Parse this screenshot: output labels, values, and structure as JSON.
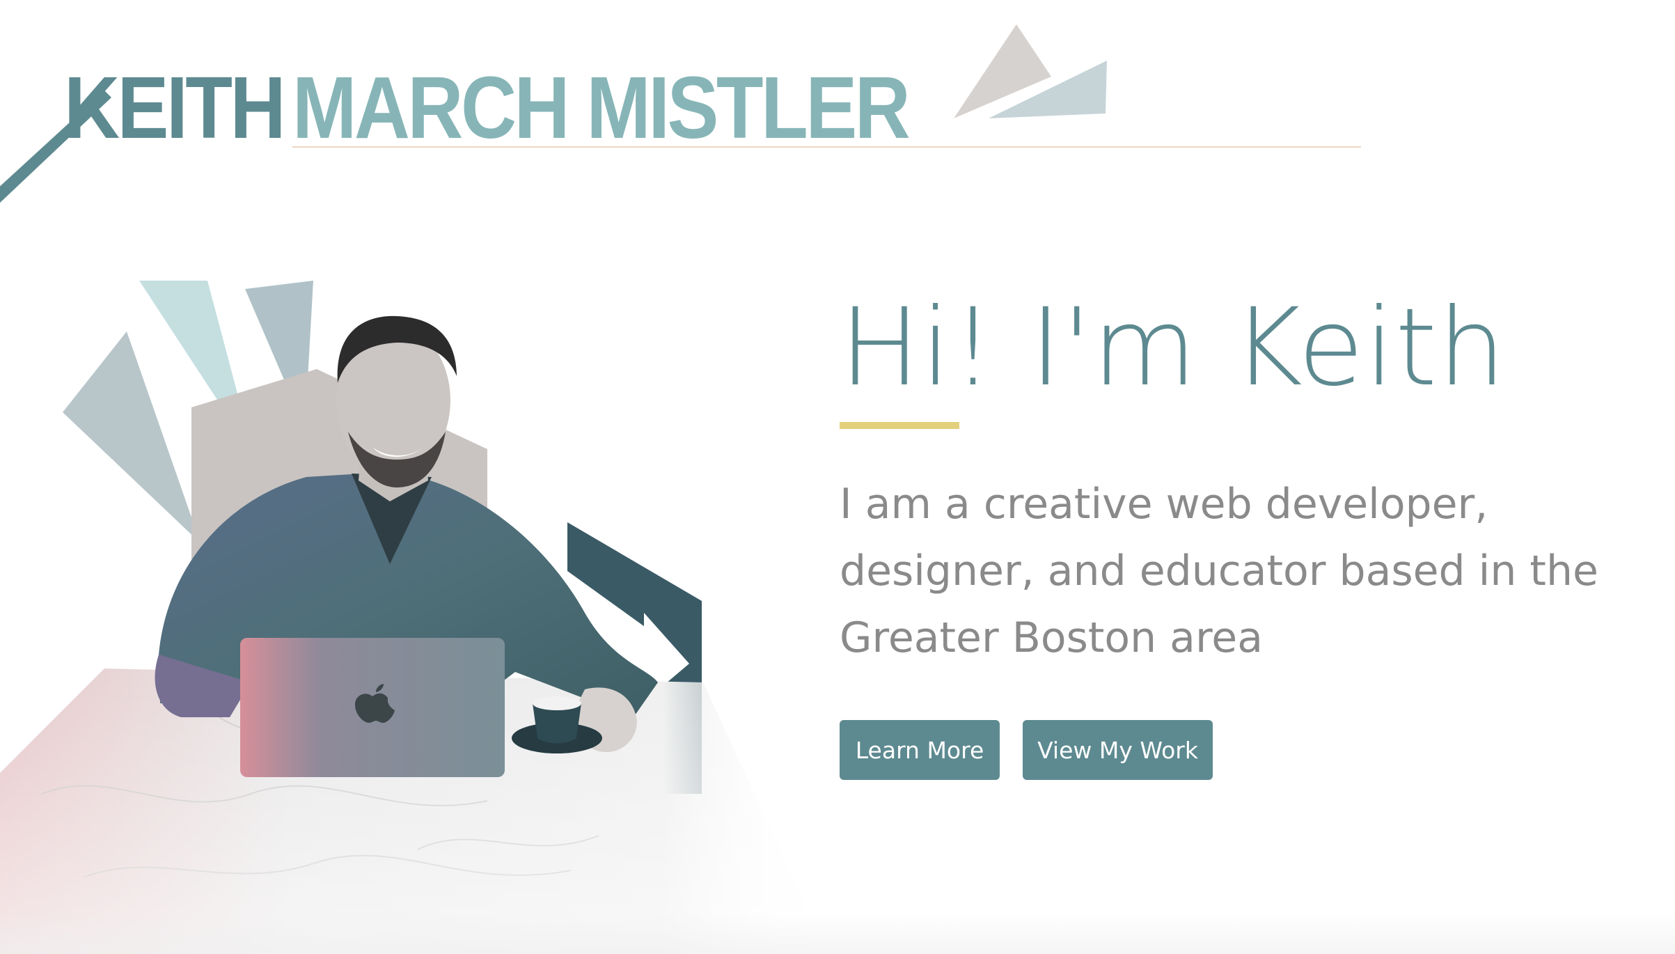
{
  "logo": {
    "first_name": "KEITH",
    "last_name": "MARCH MISTLER"
  },
  "hero": {
    "title": "Hi! I'm Keith",
    "subtitle": "I am a creative web developer, designer, and educator based in the Greater Boston area",
    "buttons": {
      "learn_more": "Learn More",
      "view_work": "View My Work"
    }
  },
  "colors": {
    "teal": "#5d8a90",
    "light_teal": "#87b5b7",
    "accent_gold": "#e2d07c",
    "logo_underline": "#efd6c0",
    "text_gray": "#8a8a8a",
    "dark_slate": "#3a5a66"
  }
}
